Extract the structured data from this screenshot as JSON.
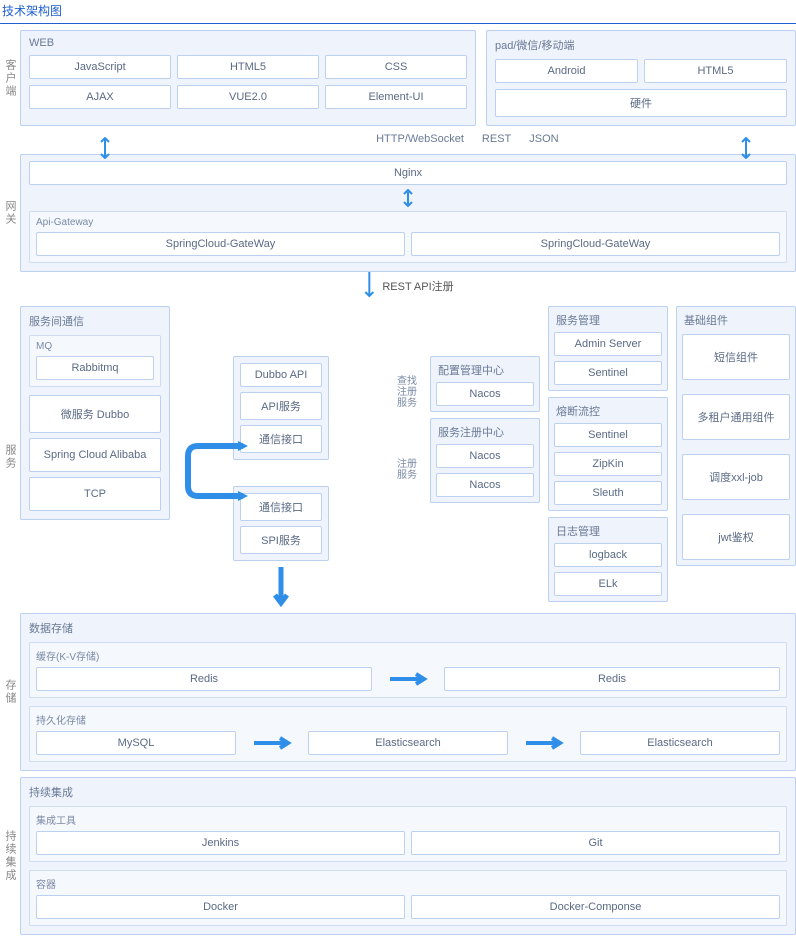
{
  "title": "技术架构图",
  "sections": {
    "client": {
      "label": "客户端",
      "web": {
        "title": "WEB",
        "row1": [
          "JavaScript",
          "HTML5",
          "CSS"
        ],
        "row2": [
          "AJAX",
          "VUE2.0",
          "Element-UI"
        ]
      },
      "mobile": {
        "title": "pad/微信/移动端",
        "row1": [
          "Android",
          "HTML5"
        ],
        "row2": [
          "硬件"
        ]
      }
    },
    "protocols": {
      "http": "HTTP/WebSocket",
      "rest": "REST",
      "json": "JSON"
    },
    "gateway": {
      "label": "网关",
      "nginx": "Nginx",
      "group": "Api-Gateway",
      "items": [
        "SpringCloud-GateWay",
        "SpringCloud-GateWay"
      ]
    },
    "restapi": "REST API注册",
    "service": {
      "label": "服务",
      "comm": {
        "title": "服务间通信",
        "mq_title": "MQ",
        "mq": "Rabbitmq",
        "items": [
          "微服务 Dubbo",
          "Spring Cloud Alibaba",
          "TCP"
        ]
      },
      "dubbo_group": [
        "Dubbo API",
        "API服务",
        "通信接口"
      ],
      "spi_group": [
        "通信接口",
        "SPI服务"
      ],
      "lookup": "查找\n注册\n服务",
      "register": "注册\n服务",
      "config_center": {
        "title": "配置管理中心",
        "items": [
          "Nacos"
        ]
      },
      "registry": {
        "title": "服务注册中心",
        "items": [
          "Nacos",
          "Nacos"
        ]
      },
      "mgmt": {
        "title": "服务管理",
        "items": [
          "Admin Server",
          "Sentinel"
        ]
      },
      "circuit": {
        "title": "熔断流控",
        "items": [
          "Sentinel",
          "ZipKin",
          "Sleuth"
        ]
      },
      "log": {
        "title": "日志管理",
        "items": [
          "logback",
          "ELk"
        ]
      },
      "base": {
        "title": "基础组件",
        "items": [
          "短信组件",
          "多租户通用组件",
          "调度xxl-job",
          "jwt鉴权"
        ]
      }
    },
    "storage": {
      "label": "存储",
      "title": "数据存储",
      "cache": {
        "title": "缓存(K-V存储)",
        "items": [
          "Redis",
          "Redis"
        ]
      },
      "persist": {
        "title": "持久化存储",
        "items": [
          "MySQL",
          "Elasticsearch",
          "Elasticsearch"
        ]
      }
    },
    "ci": {
      "label": "持续集成",
      "title": "持续集成",
      "tools": {
        "title": "集成工具",
        "items": [
          "Jenkins",
          "Git"
        ]
      },
      "container": {
        "title": "容器",
        "items": [
          "Docker",
          "Docker-Componse"
        ]
      }
    }
  }
}
